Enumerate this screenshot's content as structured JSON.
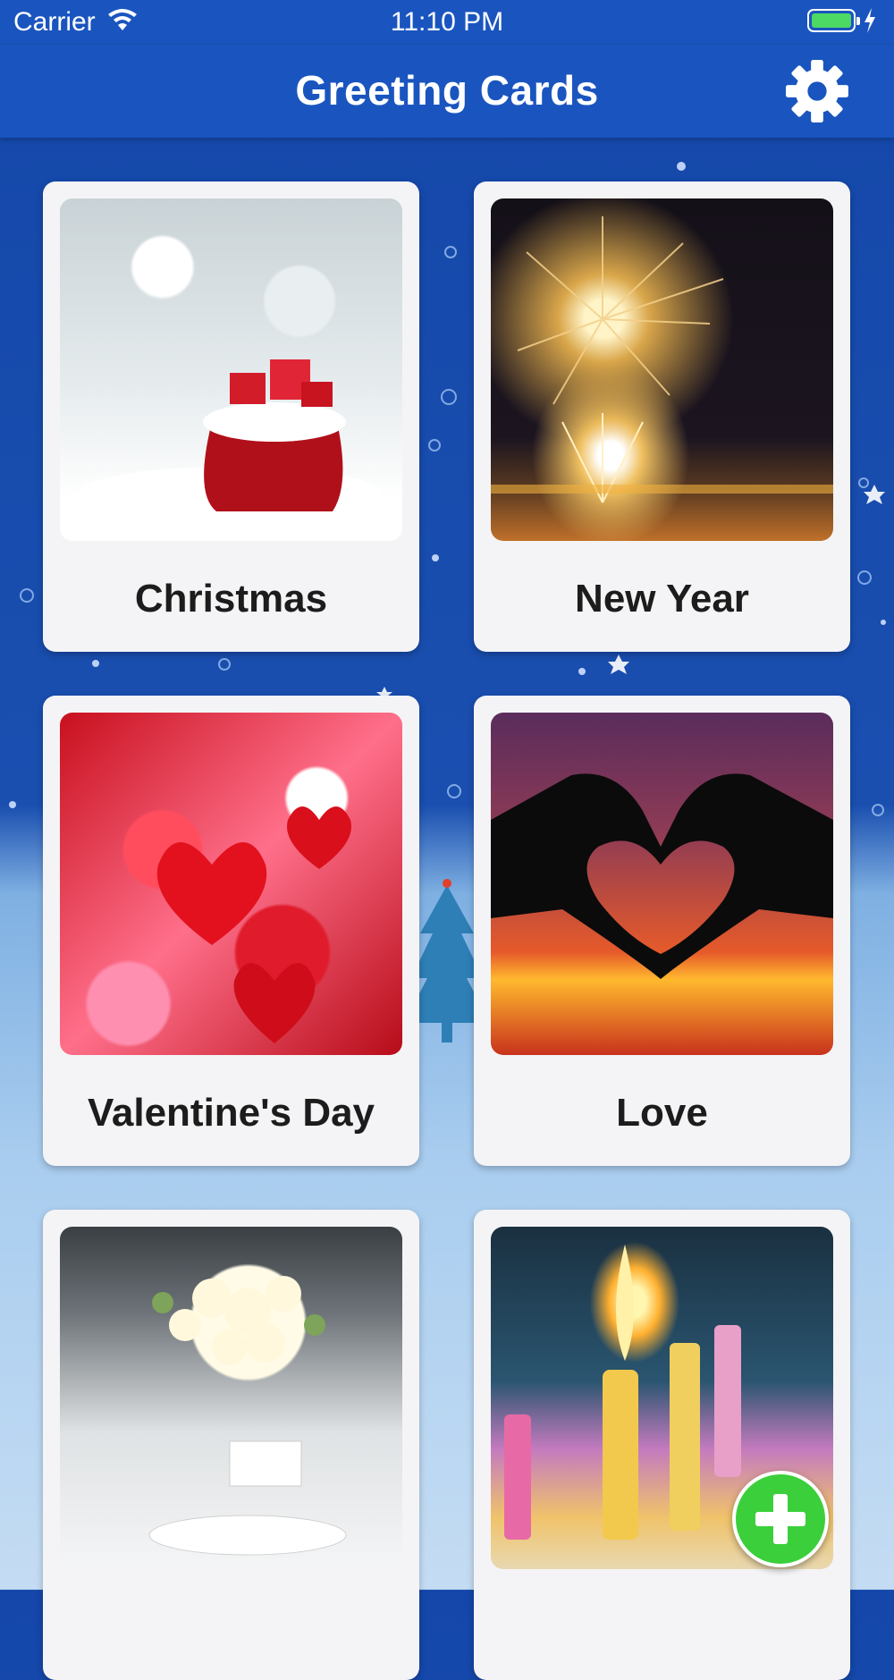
{
  "status_bar": {
    "carrier": "Carrier",
    "time": "11:10 PM"
  },
  "header": {
    "title": "Greeting Cards",
    "settings_icon": "gear-icon"
  },
  "categories": [
    {
      "label": "Christmas"
    },
    {
      "label": "New Year"
    },
    {
      "label": "Valentine's Day"
    },
    {
      "label": "Love"
    },
    {
      "label": ""
    },
    {
      "label": ""
    }
  ],
  "fab_icon": "plus-icon",
  "colors": {
    "header": "#1a55bf",
    "fab": "#3ccf3c",
    "card": "#f4f4f6"
  }
}
